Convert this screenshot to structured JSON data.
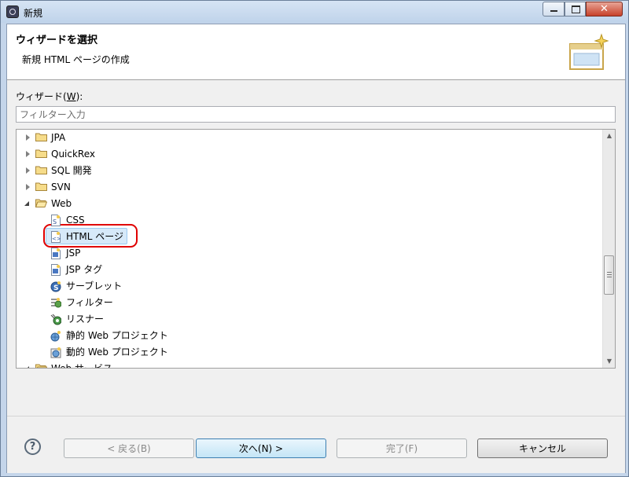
{
  "window": {
    "title": "新規"
  },
  "banner": {
    "title": "ウィザードを選択",
    "description": "新規 HTML ページの作成"
  },
  "wizard": {
    "label_prefix": "ウィザード(",
    "label_mnemonic": "W",
    "label_suffix": "):",
    "filter_placeholder": "フィルター入力"
  },
  "tree": {
    "items": [
      {
        "label": "JPA",
        "type": "folder",
        "state": "collapsed"
      },
      {
        "label": "QuickRex",
        "type": "folder",
        "state": "collapsed"
      },
      {
        "label": "SQL 開発",
        "type": "folder",
        "state": "collapsed"
      },
      {
        "label": "SVN",
        "type": "folder",
        "state": "collapsed"
      },
      {
        "label": "Web",
        "type": "folder",
        "state": "expanded"
      },
      {
        "label": "CSS",
        "type": "css-file-icon"
      },
      {
        "label": "HTML ページ",
        "type": "html-file-icon",
        "selected": true
      },
      {
        "label": "JSP",
        "type": "jsp-file-icon"
      },
      {
        "label": "JSP タグ",
        "type": "jsp-tag-icon"
      },
      {
        "label": "サーブレット",
        "type": "servlet-icon"
      },
      {
        "label": "フィルター",
        "type": "filter-icon"
      },
      {
        "label": "リスナー",
        "type": "listener-icon"
      },
      {
        "label": "静的 Web プロジェクト",
        "type": "static-web-project-icon"
      },
      {
        "label": "動的 Web プロジェクト",
        "type": "dynamic-web-project-icon"
      },
      {
        "label": "Web サービス",
        "type": "folder",
        "state": "expanded"
      }
    ]
  },
  "buttons": {
    "help": "?",
    "back": "< 戻る(B)",
    "next": "次へ(N) >",
    "finish": "完了(F)",
    "cancel": "キャンセル"
  },
  "colors": {
    "highlight": "#e00000",
    "selection": "#d6e9f9",
    "folder": "#e8c66a"
  }
}
